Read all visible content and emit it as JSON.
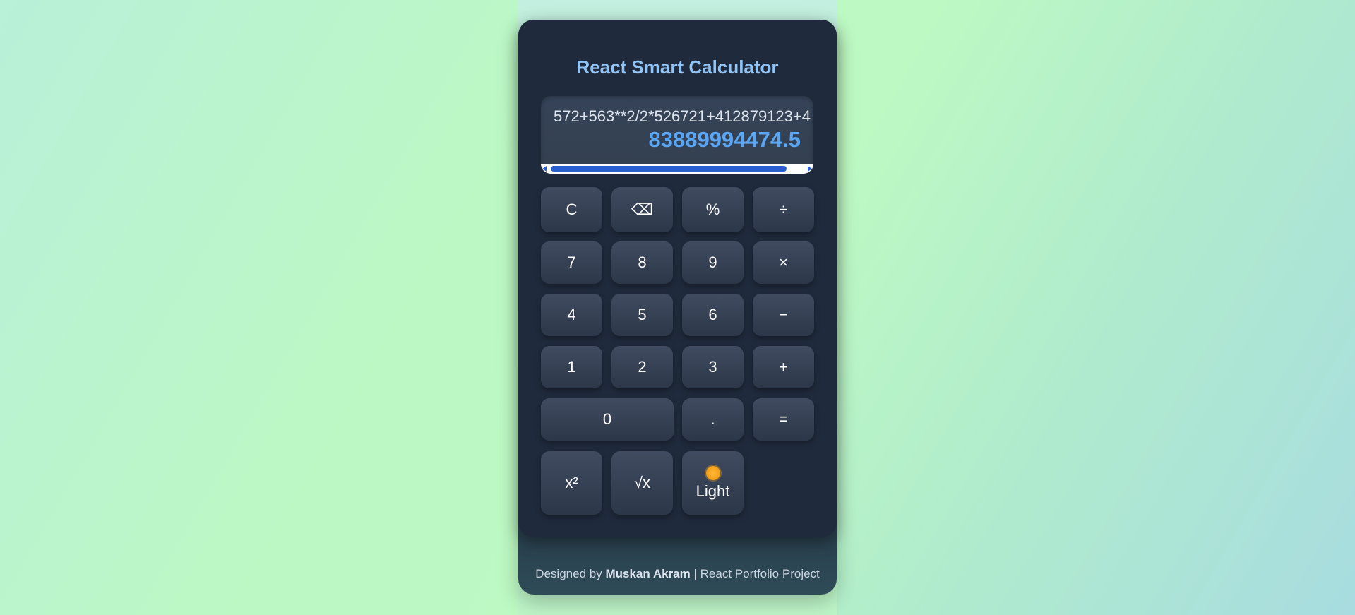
{
  "app": {
    "title": "React Smart Calculator"
  },
  "display": {
    "expression": "572+563**2/2*526721+412879123+4",
    "result": "83889994474.5"
  },
  "keys": {
    "clear": "C",
    "backspace": "⌫",
    "percent": "%",
    "divide": "÷",
    "seven": "7",
    "eight": "8",
    "nine": "9",
    "multiply": "×",
    "four": "4",
    "five": "5",
    "six": "6",
    "minus": "−",
    "one": "1",
    "two": "2",
    "three": "3",
    "plus": "+",
    "zero": "0",
    "decimal": ".",
    "equals": "=",
    "square": "x²",
    "sqrt": "√x",
    "theme_label": "Light",
    "theme_icon": "sun-icon"
  },
  "footer": {
    "prefix": "Designed by",
    "author": "Muskan Akram",
    "suffix": "| React Portfolio Project"
  },
  "colors": {
    "accent": "#5aa6f5",
    "title": "#90c4f7",
    "card": "#1f2a3c",
    "button": "#374357"
  }
}
